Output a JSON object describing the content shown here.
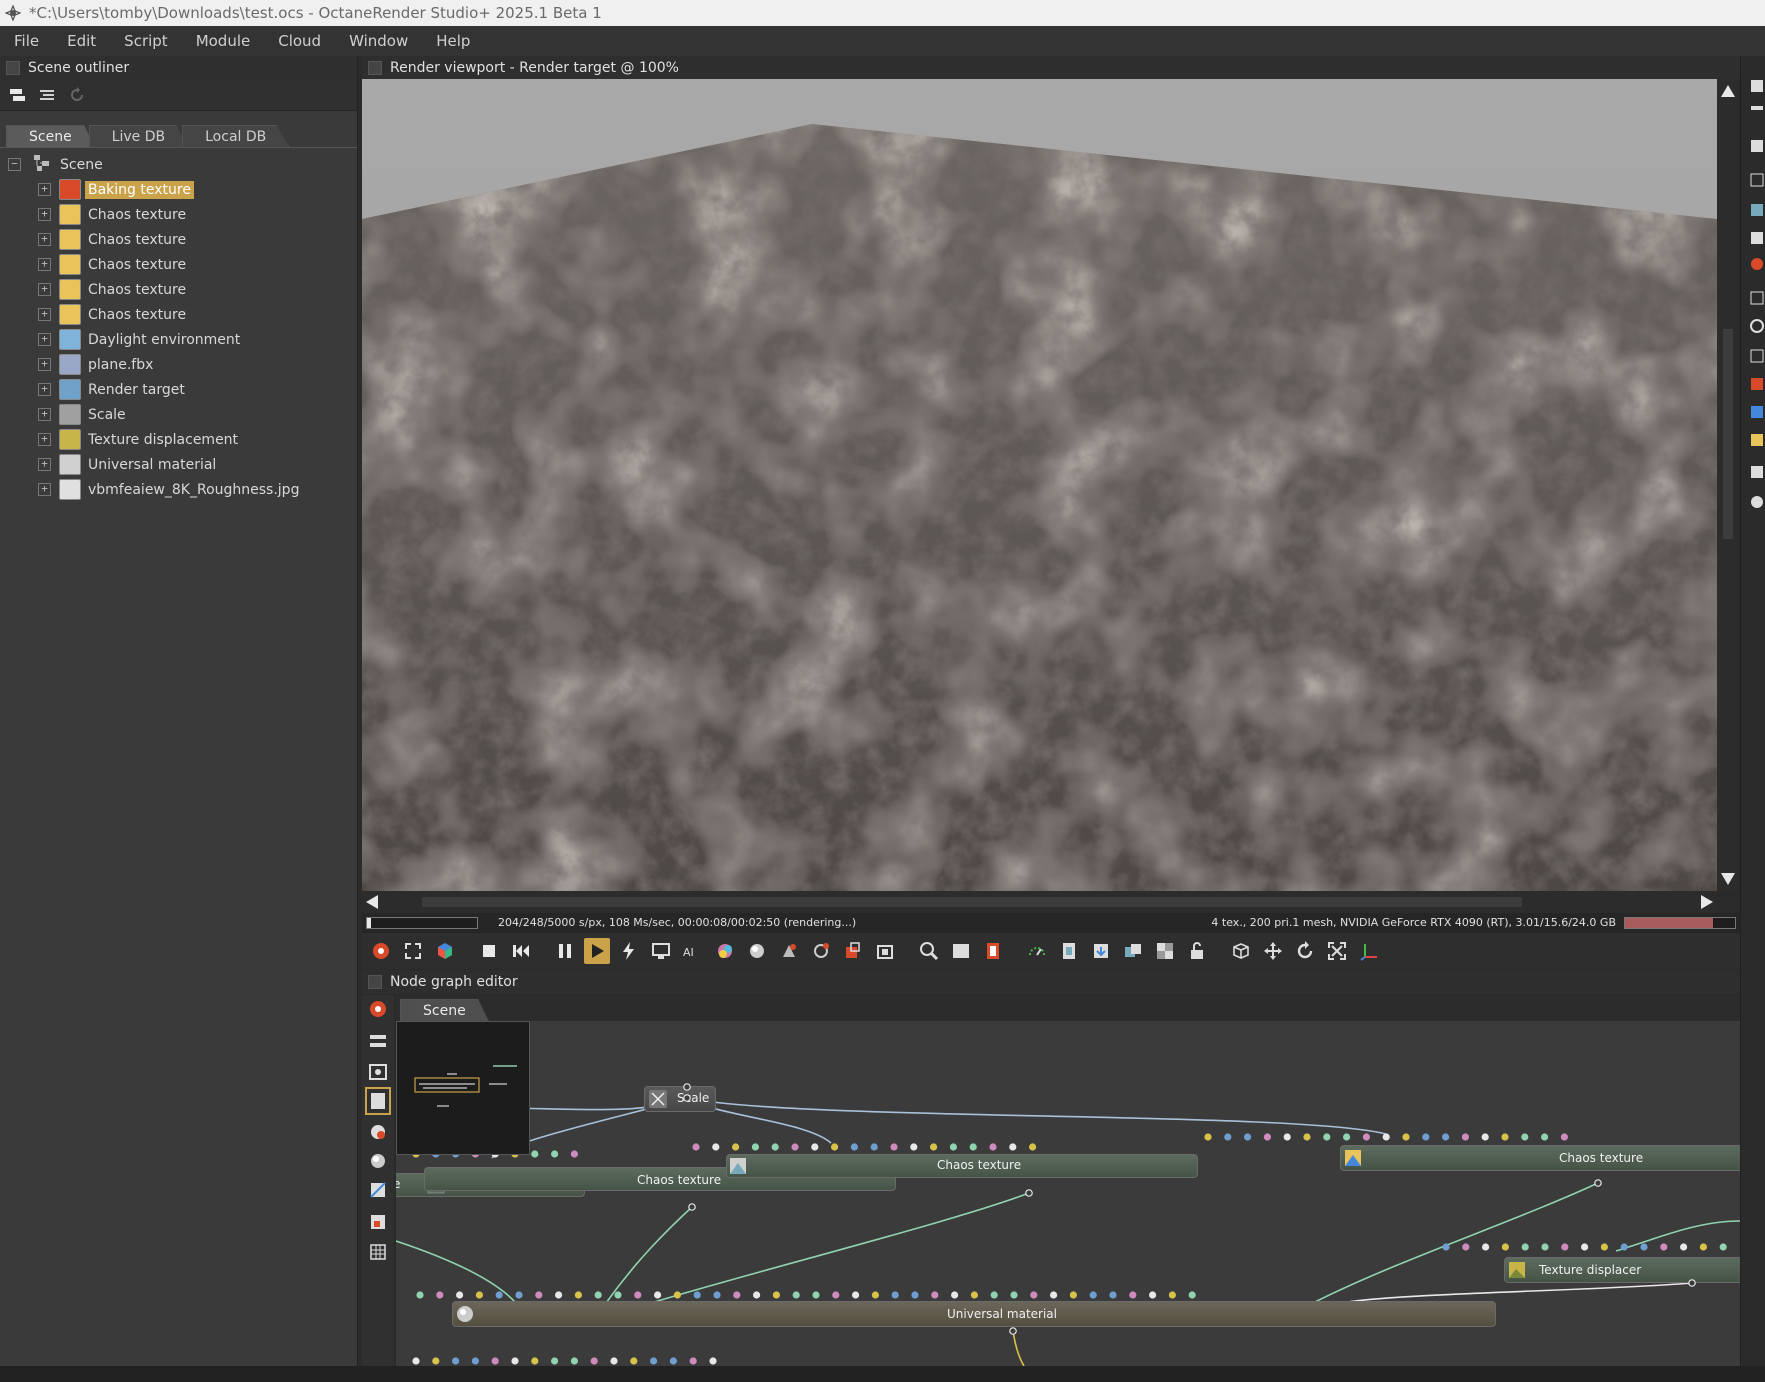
{
  "window": {
    "title": "*C:\\Users\\tomby\\Downloads\\test.ocs - OctaneRender Studio+ 2025.1 Beta 1"
  },
  "menu": [
    "File",
    "Edit",
    "Script",
    "Module",
    "Cloud",
    "Window",
    "Help"
  ],
  "outliner": {
    "title": "Scene outliner",
    "tabs": [
      "Scene",
      "Live DB",
      "Local DB"
    ],
    "root": "Scene",
    "items": [
      {
        "label": "Baking texture",
        "icon": "baking-texture-icon",
        "color": "#d94a2b",
        "selected": true
      },
      {
        "label": "Chaos texture",
        "icon": "chaos-texture-icon",
        "color": "#e8c45a"
      },
      {
        "label": "Chaos texture",
        "icon": "chaos-texture-icon",
        "color": "#e8c45a"
      },
      {
        "label": "Chaos texture",
        "icon": "chaos-texture-icon",
        "color": "#e8c45a"
      },
      {
        "label": "Chaos texture",
        "icon": "chaos-texture-icon",
        "color": "#e8c45a"
      },
      {
        "label": "Chaos texture",
        "icon": "chaos-texture-icon",
        "color": "#e8c45a"
      },
      {
        "label": "Daylight environment",
        "icon": "daylight-environment-icon",
        "color": "#7fb3d9"
      },
      {
        "label": "plane.fbx",
        "icon": "mesh-icon",
        "color": "#9aa8c8"
      },
      {
        "label": "Render target",
        "icon": "render-target-icon",
        "color": "#6fa1c9"
      },
      {
        "label": "Scale",
        "icon": "scale-icon",
        "color": "#a0a0a0"
      },
      {
        "label": "Texture displacement",
        "icon": "texture-displacement-icon",
        "color": "#c8b54a"
      },
      {
        "label": "Universal material",
        "icon": "universal-material-icon",
        "color": "#d0d0d0"
      },
      {
        "label": "vbmfeaiew_8K_Roughness.jpg",
        "icon": "image-texture-icon",
        "color": "#e0e0e0"
      }
    ]
  },
  "viewport": {
    "title": "Render viewport - Render target @ 100%",
    "status_left": "204/248/5000 s/px, 108 Ms/sec, 00:00:08/00:02:50 (rendering...)",
    "status_right": "4 tex., 200 pri.1 mesh, NVIDIA GeForce RTX 4090 (RT), 3.01/15.6/24.0 GB",
    "progress": 0.04,
    "memory_usage": 0.8
  },
  "nodegraph": {
    "title": "Node graph editor",
    "tab": "Scene",
    "nodes": {
      "scale": "Scale",
      "chaos_a": "Chaos texture",
      "chaos_b": "Chaos texture",
      "chaos_c": "Chaos texture",
      "partial": "e",
      "texture_displacement": "Texture displacer",
      "universal_material": "Universal material"
    }
  },
  "colors": {
    "accent": "#c9a24a",
    "pin_yellow": "#d9c24a",
    "pin_blue": "#6f9fd0",
    "pin_pink": "#cf8bbd",
    "pin_green": "#8fd3b0",
    "pin_white": "#e8e8e8",
    "wire": "#a8c0d8"
  }
}
